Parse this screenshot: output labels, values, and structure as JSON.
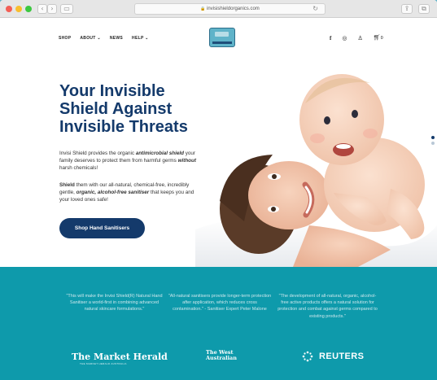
{
  "browser": {
    "url": "invisishieldorganics.com",
    "back_icon": "back-arrow-icon",
    "forward_icon": "forward-arrow-icon",
    "reload_icon": "reload-icon"
  },
  "nav": {
    "items": [
      "SHOP",
      "ABOUT ⌄",
      "NEWS",
      "HELP ⌄"
    ]
  },
  "header_icons": [
    "facebook-icon",
    "instagram-icon",
    "account-icon",
    "cart-icon"
  ],
  "cart": {
    "count": "0"
  },
  "hero": {
    "title_lines": [
      "Your Invisible",
      "Shield Against",
      "Invisible Threats"
    ],
    "p1": {
      "a": "Invisi Shield provides the organic ",
      "b": "antimicrobial shield",
      "c": " your family deserves to protect them from harmful germs ",
      "d": "without",
      "e": " harsh chemicals!"
    },
    "p2": {
      "a": "Shield",
      "b": " them with our all-natural, chemical-free, incredibly gentle, ",
      "c": "organic, alcohol-free sanitiser",
      "d": " that keeps you and your loved ones safe!"
    },
    "cta": "Shop Hand Sanitisers"
  },
  "quotes": [
    "\"This will make the Invisi Shield(R) Natural Hand Sanitiser a world-first in combining advanced natural skincare formulations.\"",
    "\"All-natural sanitisers provide longer-term protection after application, which reduces cross contamination.\" - Sanitiser Expert Peter Malone",
    "\"The development of all-natural, organic, alcohol-free active products offers a natural solution for protection and combat against germs compared to existing products.\""
  ],
  "press": {
    "market_herald": "The Market Herald",
    "market_herald_sub": "THE MARKET HERALD AUSTRALIA",
    "west_australian": "The West Australian",
    "reuters": "REUTERS"
  },
  "colors": {
    "navy": "#143a6b",
    "teal_band": "#0e9aab",
    "logo_blue": "#5fb3c9"
  }
}
